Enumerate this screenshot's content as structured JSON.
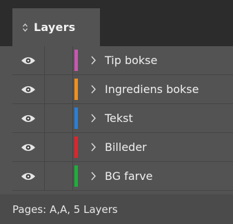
{
  "panel": {
    "tab": {
      "label": "Layers",
      "icon": "sort-arrows-icon"
    },
    "layers": [
      {
        "name": "Tip bokse",
        "color": "#c758b0",
        "visible": true,
        "icon": "eye-icon"
      },
      {
        "name": "Ingrediens bokse",
        "color": "#f0901e",
        "visible": true,
        "icon": "eye-icon"
      },
      {
        "name": "Tekst",
        "color": "#2a7fd4",
        "visible": true,
        "icon": "eye-icon"
      },
      {
        "name": "Billeder",
        "color": "#e0242b",
        "visible": true,
        "icon": "eye-icon"
      },
      {
        "name": "BG farve",
        "color": "#1fae3a",
        "visible": true,
        "icon": "eye-icon"
      }
    ],
    "status": "Pages: A,A, 5 Layers"
  }
}
